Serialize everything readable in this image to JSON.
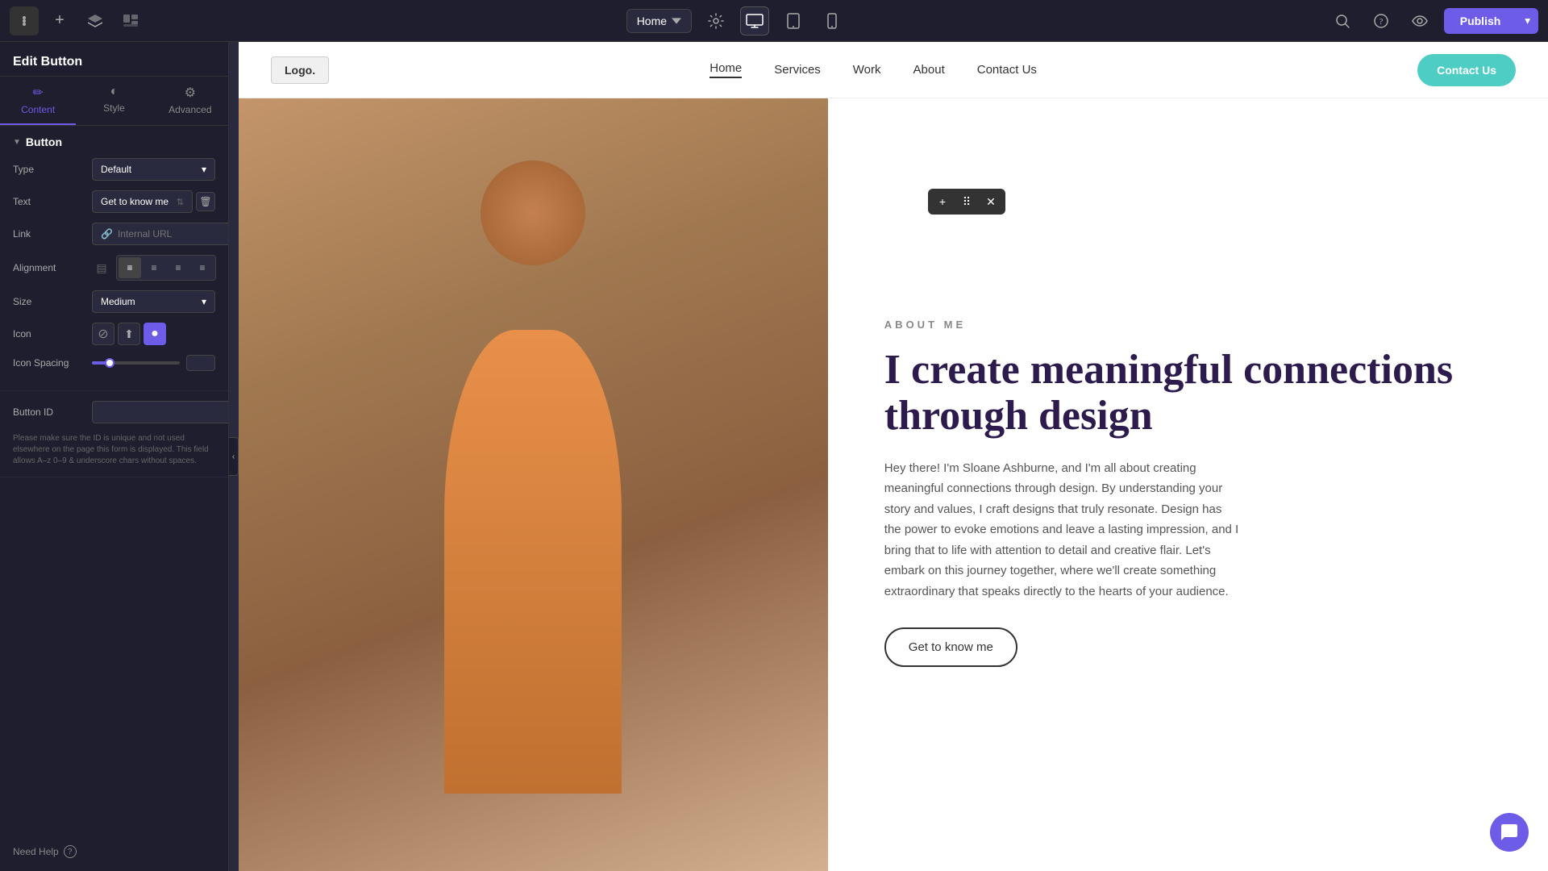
{
  "topbar": {
    "hamburger_icon": "☰",
    "plus_icon": "+",
    "layers_icon": "⊞",
    "pages_icon": "◧",
    "home_label": "Home",
    "chevron_icon": "▾",
    "settings_icon": "⚙",
    "desktop_icon": "🖥",
    "tablet_icon": "📱",
    "mobile_icon": "📱",
    "search_icon": "🔍",
    "help_icon": "?",
    "eye_icon": "👁",
    "publish_label": "Publish",
    "dropdown_icon": "▾"
  },
  "left_panel": {
    "title": "Edit Button",
    "tabs": [
      {
        "id": "content",
        "label": "Content",
        "icon": "✏"
      },
      {
        "id": "style",
        "label": "Style",
        "icon": "◐"
      },
      {
        "id": "advanced",
        "label": "Advanced",
        "icon": "⚙"
      }
    ],
    "button_section": {
      "label": "Button",
      "arrow": "▼"
    },
    "type_label": "Type",
    "type_value": "Default",
    "text_label": "Text",
    "text_value": "Get to know me",
    "link_label": "Link",
    "link_placeholder": "Internal URL",
    "link_icon": "🔗",
    "alignment_label": "Alignment",
    "size_label": "Size",
    "size_value": "Medium",
    "icon_label": "Icon",
    "icon_spacing_label": "Icon Spacing",
    "button_id_label": "Button ID",
    "hint_text": "Please make sure the ID is unique and not used elsewhere on the page this form is displayed. This field allows A–z 0–9 & underscore chars without spaces.",
    "need_help_label": "Need Help"
  },
  "preview": {
    "nav": {
      "logo": "Logo.",
      "links": [
        "Home",
        "Services",
        "Work",
        "About",
        "Contact Us"
      ],
      "active_link": "Home",
      "cta_label": "Contact Us"
    },
    "hero": {
      "about_label": "ABOUT ME",
      "title": "I create meaningful connections through design",
      "description": "Hey there! I'm Sloane Ashburne, and I'm all about creating meaningful connections through design. By understanding your story and values, I craft designs that truly resonate. Design has the power to evoke emotions and leave a lasting impression, and I bring that to life with attention to detail and creative flair. Let's embark on this journey together, where we'll create something extraordinary that speaks directly to the hearts of your audience.",
      "cta_label": "Get to know me"
    }
  }
}
